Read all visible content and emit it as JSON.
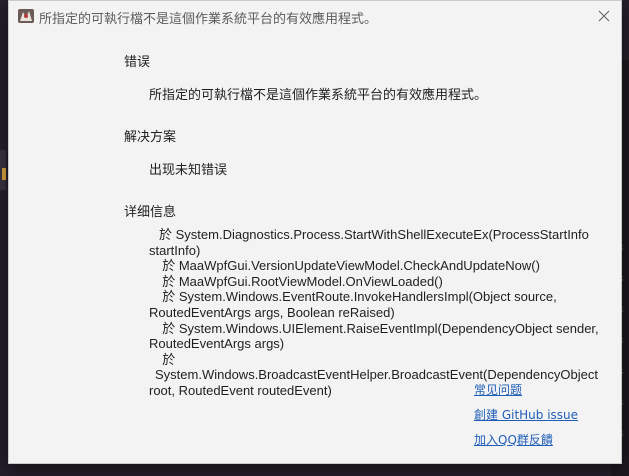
{
  "window": {
    "title": "所指定的可執行檔不是這個作業系統平台的有效應用程式。"
  },
  "error": {
    "heading": "错误",
    "message": "所指定的可執行檔不是這個作業系統平台的有效應用程式。"
  },
  "solution": {
    "heading": "解决方案",
    "message": "出现未知错误"
  },
  "details": {
    "heading": "详细信息",
    "stack": [
      "於 System.Diagnostics.Process.StartWithShellExecuteEx(ProcessStartInfo",
      "startInfo)",
      "  於 MaaWpfGui.VersionUpdateViewModel.CheckAndUpdateNow()",
      "  於 MaaWpfGui.RootViewModel.OnViewLoaded()",
      "  於 System.Windows.EventRoute.InvokeHandlersImpl(Object source,",
      "RoutedEventArgs args, Boolean reRaised)",
      "  於 System.Windows.UIElement.RaiseEventImpl(DependencyObject sender,",
      "RoutedEventArgs args)",
      "  於 System.Windows.BroadcastEventHelper.BroadcastEvent(DependencyObject",
      "root, RoutedEvent routedEvent)"
    ]
  },
  "links": {
    "faq": "常见问题",
    "github_issue": "創建 GitHub issue",
    "qq_feedback": "加入QQ群反饋"
  },
  "background": {
    "right_marks": [
      "3",
      "3",
      "3",
      "3",
      "3",
      "3",
      "3"
    ]
  },
  "colors": {
    "dialog_bg": "#f3f3f3",
    "link": "#1f5eb8",
    "text": "#1f1f1f"
  }
}
